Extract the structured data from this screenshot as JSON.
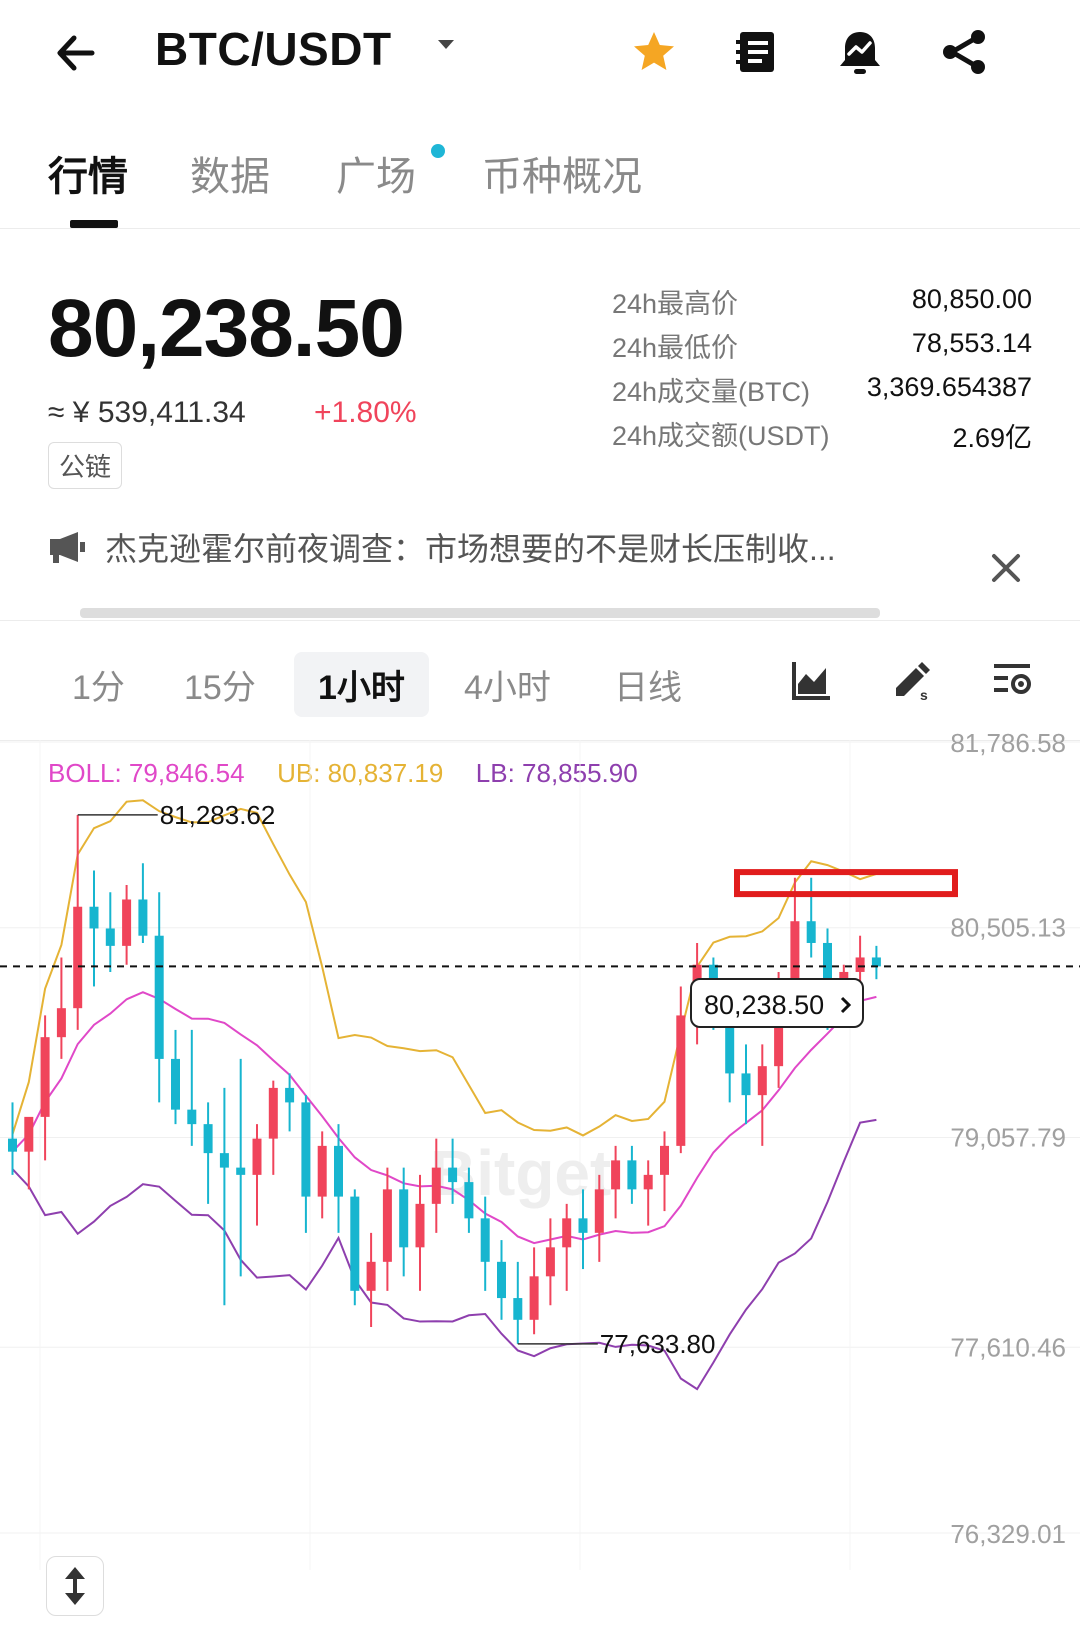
{
  "header": {
    "pair": "BTC/USDT",
    "icons": [
      "back-arrow-icon",
      "caret-down-icon",
      "star-icon",
      "order-book-icon",
      "price-alert-icon",
      "share-icon"
    ]
  },
  "tabs": [
    {
      "label": "行情",
      "active": true
    },
    {
      "label": "数据",
      "active": false
    },
    {
      "label": "广场",
      "active": false,
      "dot": true
    },
    {
      "label": "币种概况",
      "active": false
    }
  ],
  "price": {
    "last": "80,238.50",
    "cny": "≈ ¥ 539,411.34",
    "change": "+1.80%",
    "badge": "公链"
  },
  "stats": [
    {
      "label": "24h最高价",
      "value": "80,850.00"
    },
    {
      "label": "24h最低价",
      "value": "78,553.14"
    },
    {
      "label": "24h成交量(BTC)",
      "value": "3,369.654387"
    },
    {
      "label": "24h成交额(USDT)",
      "value": "2.69亿"
    }
  ],
  "news": {
    "headline": "杰克逊霍尔前夜调查：市场想要的不是财长压制收...",
    "icons": [
      "megaphone-icon",
      "close-icon"
    ]
  },
  "intervals": [
    {
      "label": "1分",
      "active": false
    },
    {
      "label": "15分",
      "active": false
    },
    {
      "label": "1小时",
      "active": true
    },
    {
      "label": "4小时",
      "active": false
    },
    {
      "label": "日线",
      "active": false
    }
  ],
  "tools": [
    "chart-type-icon",
    "draw-tool-icon",
    "indicator-settings-icon"
  ],
  "boll": {
    "boll": "BOLL: 79,846.54",
    "ub": "UB: 80,837.19",
    "lb": "LB: 78,855.90"
  },
  "colors": {
    "up": "#f0445b",
    "down": "#17b5cf",
    "boll_mid": "#e048c8",
    "boll_ub": "#e5b335",
    "boll_lb": "#8e3fae",
    "highlight": "#e11d1d",
    "star": "#f5a623"
  },
  "chart_data": {
    "type": "candlestick",
    "y_axis_labels": [
      "81,786.58",
      "80,505.13",
      "79,057.79",
      "77,610.46",
      "76,329.01"
    ],
    "max_annotation": "81,283.62",
    "min_annotation": "77,633.80",
    "current_price": "80,238.50",
    "watermark": "Bitget",
    "ylim": [
      76329.01,
      81786.58
    ],
    "candles": [
      {
        "o": 79050,
        "h": 79300,
        "l": 78800,
        "c": 78960
      },
      {
        "o": 78960,
        "h": 79100,
        "l": 78700,
        "c": 79200
      },
      {
        "o": 79200,
        "h": 79900,
        "l": 78900,
        "c": 79750
      },
      {
        "o": 79750,
        "h": 80300,
        "l": 79600,
        "c": 79950
      },
      {
        "o": 79950,
        "h": 81283,
        "l": 79800,
        "c": 80650
      },
      {
        "o": 80650,
        "h": 80900,
        "l": 80100,
        "c": 80500
      },
      {
        "o": 80500,
        "h": 80750,
        "l": 80200,
        "c": 80380
      },
      {
        "o": 80380,
        "h": 80800,
        "l": 80250,
        "c": 80700
      },
      {
        "o": 80700,
        "h": 80950,
        "l": 80400,
        "c": 80450
      },
      {
        "o": 80450,
        "h": 80750,
        "l": 79300,
        "c": 79600
      },
      {
        "o": 79600,
        "h": 79800,
        "l": 79150,
        "c": 79250
      },
      {
        "o": 79250,
        "h": 79800,
        "l": 79000,
        "c": 79150
      },
      {
        "o": 79150,
        "h": 79300,
        "l": 78600,
        "c": 78950
      },
      {
        "o": 78950,
        "h": 79400,
        "l": 77900,
        "c": 78850
      },
      {
        "o": 78850,
        "h": 79600,
        "l": 78100,
        "c": 78800
      },
      {
        "o": 78800,
        "h": 79150,
        "l": 78450,
        "c": 79050
      },
      {
        "o": 79050,
        "h": 79450,
        "l": 78800,
        "c": 79400
      },
      {
        "o": 79400,
        "h": 79500,
        "l": 79100,
        "c": 79300
      },
      {
        "o": 79300,
        "h": 79350,
        "l": 78400,
        "c": 78650
      },
      {
        "o": 78650,
        "h": 79100,
        "l": 78500,
        "c": 79000
      },
      {
        "o": 79000,
        "h": 79150,
        "l": 78400,
        "c": 78650
      },
      {
        "o": 78650,
        "h": 78700,
        "l": 77900,
        "c": 78000
      },
      {
        "o": 78000,
        "h": 78400,
        "l": 77750,
        "c": 78200
      },
      {
        "o": 78200,
        "h": 78850,
        "l": 78000,
        "c": 78700
      },
      {
        "o": 78700,
        "h": 78850,
        "l": 78100,
        "c": 78300
      },
      {
        "o": 78300,
        "h": 78800,
        "l": 78000,
        "c": 78600
      },
      {
        "o": 78600,
        "h": 79050,
        "l": 78400,
        "c": 78850
      },
      {
        "o": 78850,
        "h": 79050,
        "l": 78600,
        "c": 78750
      },
      {
        "o": 78750,
        "h": 78850,
        "l": 78400,
        "c": 78500
      },
      {
        "o": 78500,
        "h": 78650,
        "l": 78000,
        "c": 78200
      },
      {
        "o": 78200,
        "h": 78350,
        "l": 77800,
        "c": 77950
      },
      {
        "o": 77950,
        "h": 78200,
        "l": 77633.8,
        "c": 77800
      },
      {
        "o": 77800,
        "h": 78300,
        "l": 77700,
        "c": 78100
      },
      {
        "o": 78100,
        "h": 78500,
        "l": 77900,
        "c": 78300
      },
      {
        "o": 78300,
        "h": 78600,
        "l": 78000,
        "c": 78500
      },
      {
        "o": 78500,
        "h": 78700,
        "l": 78150,
        "c": 78400
      },
      {
        "o": 78400,
        "h": 78800,
        "l": 78200,
        "c": 78700
      },
      {
        "o": 78700,
        "h": 79000,
        "l": 78500,
        "c": 78900
      },
      {
        "o": 78900,
        "h": 79000,
        "l": 78600,
        "c": 78700
      },
      {
        "o": 78700,
        "h": 78900,
        "l": 78450,
        "c": 78800
      },
      {
        "o": 78800,
        "h": 79100,
        "l": 78550,
        "c": 79000
      },
      {
        "o": 79000,
        "h": 80100,
        "l": 78950,
        "c": 79900
      },
      {
        "o": 79900,
        "h": 80400,
        "l": 79700,
        "c": 80250
      },
      {
        "o": 80250,
        "h": 80300,
        "l": 79800,
        "c": 79900
      },
      {
        "o": 79900,
        "h": 80100,
        "l": 79300,
        "c": 79500
      },
      {
        "o": 79500,
        "h": 79700,
        "l": 79150,
        "c": 79350
      },
      {
        "o": 79350,
        "h": 79700,
        "l": 79000,
        "c": 79550
      },
      {
        "o": 79550,
        "h": 80200,
        "l": 79400,
        "c": 80050
      },
      {
        "o": 80050,
        "h": 80850,
        "l": 79900,
        "c": 80550
      },
      {
        "o": 80550,
        "h": 80850,
        "l": 80300,
        "c": 80400
      },
      {
        "o": 80400,
        "h": 80500,
        "l": 79800,
        "c": 80050
      },
      {
        "o": 80050,
        "h": 80250,
        "l": 79900,
        "c": 80200
      },
      {
        "o": 80200,
        "h": 80450,
        "l": 80100,
        "c": 80300
      },
      {
        "o": 80300,
        "h": 80380,
        "l": 80150,
        "c": 80238.5
      }
    ]
  }
}
